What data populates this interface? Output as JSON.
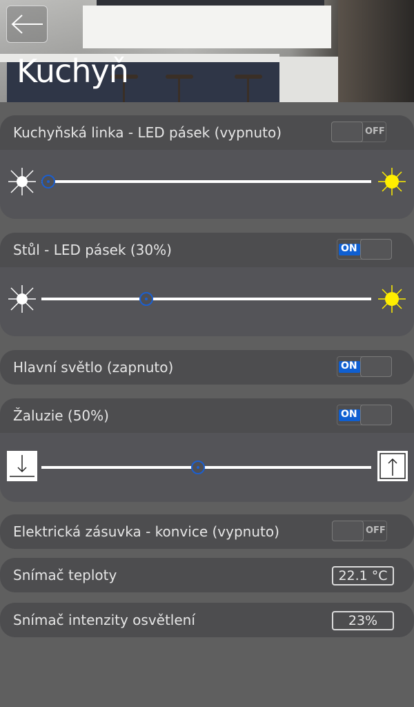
{
  "header": {
    "title": "Kuchyň",
    "back_icon": "arrow-left-icon"
  },
  "controls": {
    "led_kitchen": {
      "label": "Kuchyňská linka - LED pásek (vypnuto)",
      "toggle": "OFF",
      "level_percent": 0,
      "icon_min": "sun-dim-icon",
      "icon_max": "sun-bright-icon"
    },
    "led_table": {
      "label": "Stůl - LED pásek (30%)",
      "toggle": "ON",
      "level_percent": 30,
      "icon_min": "sun-dim-icon",
      "icon_max": "sun-bright-icon"
    },
    "main_light": {
      "label": "Hlavní světlo (zapnuto)",
      "toggle": "ON"
    },
    "blinds": {
      "label": "Žaluzie (50%)",
      "toggle": "ON",
      "level_percent": 50,
      "icon_min": "arrow-down-icon",
      "icon_max": "arrow-up-icon"
    },
    "socket": {
      "label": "Elektrická zásuvka - konvice (vypnuto)",
      "toggle": "OFF"
    },
    "temp_sensor": {
      "label": "Snímač teploty",
      "value": "22.1 °C"
    },
    "light_sensor": {
      "label": "Snímač intenzity osvětlení",
      "value": "23%"
    }
  },
  "colors": {
    "accent": "#1b5fd0",
    "sun": "#ffee00",
    "background": "#5f5f5f",
    "card": "#545458"
  }
}
